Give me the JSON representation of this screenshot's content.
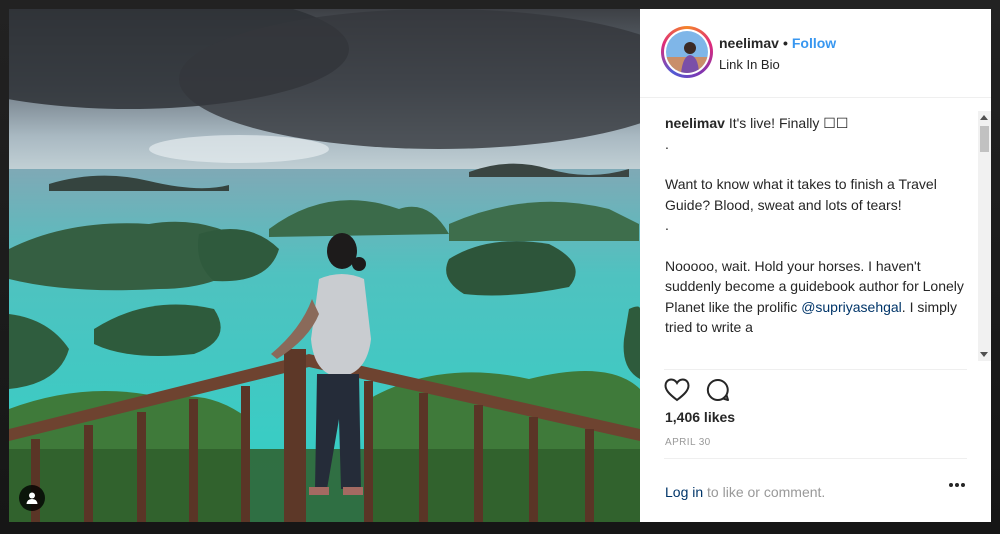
{
  "post": {
    "username": "neelimav",
    "dot": "•",
    "follow_label": "Follow",
    "subtitle": "Link In Bio",
    "caption_user": "neelimav",
    "caption_first": "It's live! Finally ☐☐",
    "caption_lines": [
      ".",
      "Want to know what it takes to finish a Travel Guide? Blood, sweat and lots of tears!",
      ".",
      "Nooooo, wait. Hold your horses. I haven't suddenly become a guidebook author for Lonely Planet like the prolific"
    ],
    "mention": "@supriyasehgal",
    "caption_tail": ". I simply tried to write a",
    "likes": "1,406 likes",
    "date": "APRIL 30",
    "login_link": "Log in",
    "login_rest": " to like or comment."
  },
  "icons": {
    "like": "heart-outline-icon",
    "comment": "comment-bubble-icon",
    "more": "more-options-icon",
    "tag": "user-tag-icon"
  },
  "colors": {
    "link_blue": "#3897f0",
    "mention_navy": "#003569",
    "text": "#262626",
    "muted": "#999999"
  }
}
